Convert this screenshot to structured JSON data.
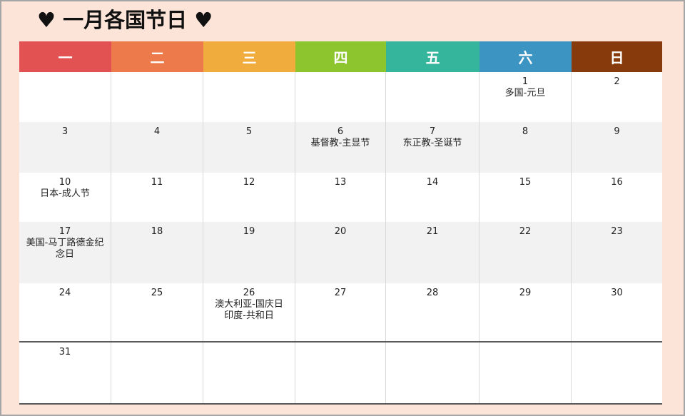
{
  "title": "♥ 一月各国节日 ♥",
  "colors": {
    "background": "#fce4d8",
    "headers": [
      "#e35252",
      "#ec7a4a",
      "#f0ad3e",
      "#8dc52e",
      "#36b59d",
      "#3b94c1",
      "#873a0c"
    ]
  },
  "weekdays": [
    "一",
    "二",
    "三",
    "四",
    "五",
    "六",
    "日"
  ],
  "weeks": [
    [
      {
        "day": "",
        "events": []
      },
      {
        "day": "",
        "events": []
      },
      {
        "day": "",
        "events": []
      },
      {
        "day": "",
        "events": []
      },
      {
        "day": "",
        "events": []
      },
      {
        "day": "1",
        "events": [
          "多国-元旦"
        ]
      },
      {
        "day": "2",
        "events": []
      }
    ],
    [
      {
        "day": "3",
        "events": []
      },
      {
        "day": "4",
        "events": []
      },
      {
        "day": "5",
        "events": []
      },
      {
        "day": "6",
        "events": [
          "基督教-主显节"
        ]
      },
      {
        "day": "7",
        "events": [
          "东正教-圣诞节"
        ]
      },
      {
        "day": "8",
        "events": []
      },
      {
        "day": "9",
        "events": []
      }
    ],
    [
      {
        "day": "10",
        "events": [
          "日本-成人节"
        ]
      },
      {
        "day": "11",
        "events": []
      },
      {
        "day": "12",
        "events": []
      },
      {
        "day": "13",
        "events": []
      },
      {
        "day": "14",
        "events": []
      },
      {
        "day": "15",
        "events": []
      },
      {
        "day": "16",
        "events": []
      }
    ],
    [
      {
        "day": "17",
        "events": [
          "美国-马丁路德金纪念日"
        ]
      },
      {
        "day": "18",
        "events": []
      },
      {
        "day": "19",
        "events": []
      },
      {
        "day": "20",
        "events": []
      },
      {
        "day": "21",
        "events": []
      },
      {
        "day": "22",
        "events": []
      },
      {
        "day": "23",
        "events": []
      }
    ],
    [
      {
        "day": "24",
        "events": []
      },
      {
        "day": "25",
        "events": []
      },
      {
        "day": "26",
        "events": [
          "澳大利亚-国庆日",
          "印度-共和日"
        ]
      },
      {
        "day": "27",
        "events": []
      },
      {
        "day": "28",
        "events": []
      },
      {
        "day": "29",
        "events": []
      },
      {
        "day": "30",
        "events": []
      }
    ],
    [
      {
        "day": "31",
        "events": []
      },
      {
        "day": "",
        "events": []
      },
      {
        "day": "",
        "events": []
      },
      {
        "day": "",
        "events": []
      },
      {
        "day": "",
        "events": []
      },
      {
        "day": "",
        "events": []
      },
      {
        "day": "",
        "events": []
      }
    ]
  ]
}
